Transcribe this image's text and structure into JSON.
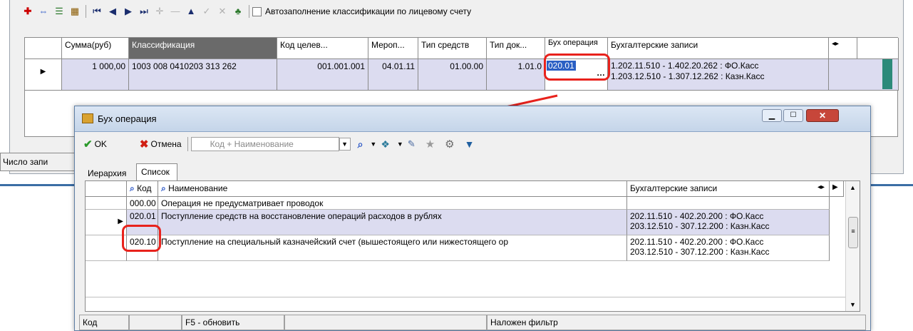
{
  "toolbar": {
    "autofill_label": "Автозаполнение классификации по лицевому счету"
  },
  "main_grid": {
    "headers": [
      "Сумма(руб)",
      "Классификация",
      "Код целев...",
      "Мероп...",
      "Тип средств",
      "Тип док...",
      "Бух операция",
      "Бухгалтерские записи"
    ],
    "row": {
      "sum": "1 000,00",
      "classification": "1003 008 0410203 313 262",
      "target_code": "001.001.001",
      "event": "04.01.11",
      "funds_type": "01.00.00",
      "doc_type": "1.01.0",
      "operation": "020.01",
      "entries_line1": "1.202.11.510 - 1.402.20.262 : ФО.Касс",
      "entries_line2": "1.203.12.510 - 1.307.12.262 : Казн.Касс"
    }
  },
  "bg_status": {
    "count_label": "Число запи"
  },
  "dialog": {
    "title": "Бух операция",
    "ok_label": "OK",
    "cancel_label": "Отмена",
    "search_placeholder": "Код + Наименование",
    "tabs": [
      "Иерархия",
      "Список"
    ],
    "active_tab": "Список",
    "headers": [
      "Код",
      "Наименование",
      "Бухгалтерские записи"
    ],
    "rows": [
      {
        "code": "000.00",
        "name": "Операция не предусматривает проводок",
        "entry1": "",
        "entry2": ""
      },
      {
        "code": "020.01",
        "name": "Поступление средств на восстановление операций расходов в рублях",
        "entry1": "202.11.510 - 402.20.200 : ФО.Касс",
        "entry2": "203.12.510 - 307.12.200 : Казн.Касс"
      },
      {
        "code": "020.10",
        "name": "Поступление на специальный казначейский счет (вышестоящего или нижестоящего ор",
        "entry1": "202.11.510 - 402.20.200 : ФО.Касс",
        "entry2": "203.12.510 - 307.12.200 : Казн.Касс"
      }
    ],
    "selected_row_index": 1,
    "status": [
      "Код",
      "",
      "F5 - обновить",
      "",
      "Наложен фильтр"
    ]
  },
  "colors": {
    "highlight_red": "#e8221c",
    "selected_row": "#dcdcf0",
    "title_bar": "#c5d5e9",
    "close_button": "#c7463a"
  },
  "icons": [
    "add-icon",
    "link-icon",
    "list-icon",
    "filter-icon",
    "first-icon",
    "prev-icon",
    "next-icon",
    "last-icon",
    "tree-icon",
    "ok-check-icon",
    "cancel-x-icon",
    "search-icon",
    "star-icon",
    "gear-icon",
    "funnel-icon",
    "minimize-icon",
    "maximize-icon",
    "close-icon",
    "arrow-icon"
  ]
}
